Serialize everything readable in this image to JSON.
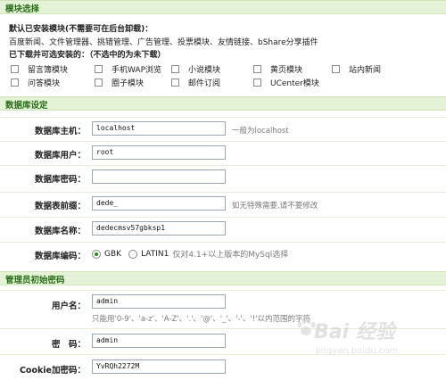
{
  "modules_header": "模块选择",
  "modules": {
    "installed_title": "默认已安装模块(不需要可在后台卸载)：",
    "installed_list": "百度新闻、文件管理器、挑错管理、广告管理、投票模块、友情链接、bShare分享插件",
    "optional_title": "已下载并可选安装的：（不选中的为未下载）",
    "options": [
      "留言簿模块",
      "手机WAP浏览",
      "小说模块",
      "黄页模块",
      "站内新闻",
      "问答模块",
      "圈子模块",
      "邮件订阅",
      "UCenter模块"
    ]
  },
  "db_header": "数据库设定",
  "db": {
    "host_label": "数据库主机：",
    "host_value": "localhost",
    "host_hint": "一般为localhost",
    "user_label": "数据库用户：",
    "user_value": "root",
    "pass_label": "数据库密码：",
    "pass_value": "",
    "prefix_label": "数据表前缀：",
    "prefix_value": "dede_",
    "prefix_hint": "如无特殊需要,请不要修改",
    "name_label": "数据库名称：",
    "name_value": "dedecmsv57gbksp1",
    "charset_label": "数据库编码：",
    "charset_options": [
      "GBK",
      "LATIN1"
    ],
    "charset_selected": "GBK",
    "charset_hint": "仅对4.1+以上版本的MySql选择"
  },
  "admin_header": "管理员初始密码",
  "admin": {
    "username_label": "用户名：",
    "username_value": "admin",
    "username_hint": "只能用'0-9'、'a-z'、'A-Z'、'.'、'@'、'_'、'-'、'!'以内范围的字符",
    "password_label": "密　码：",
    "password_value": "admin",
    "cookie_label": "Cookie加密码：",
    "cookie_value": "YvRQh2272M"
  },
  "watermark": {
    "main": "Bai 经验",
    "sub": "jingyan.baidu.com"
  }
}
